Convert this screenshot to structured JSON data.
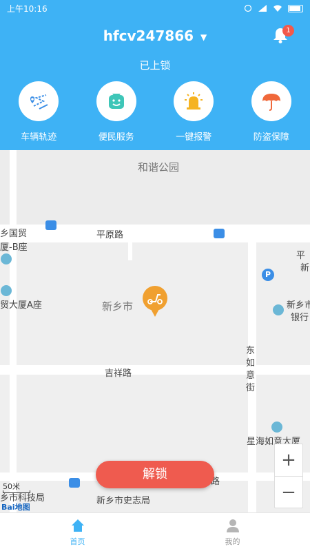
{
  "status_bar": {
    "time": "上午10:16"
  },
  "header": {
    "device_name": "hfcv247866",
    "notification_count": "1",
    "lock_status": "已上锁"
  },
  "quick_actions": [
    {
      "label": "车辆轨迹",
      "icon": "route-icon"
    },
    {
      "label": "便民服务",
      "icon": "service-icon"
    },
    {
      "label": "一键报警",
      "icon": "alarm-icon"
    },
    {
      "label": "防盗保障",
      "icon": "umbrella-icon"
    }
  ],
  "map": {
    "labels": {
      "park": "和谐公园",
      "road_pingyuan": "平原路",
      "building_left_top": "乡国贸",
      "building_left_top2": "厦-B座",
      "building_left_mid": "贸大厦A座",
      "city_center": "新乡市",
      "road_jixiang": "吉祥路",
      "street_dongru_1": "东",
      "street_dongru_2": "如",
      "street_dongru_3": "意",
      "street_dongru_4": "街",
      "bank_1": "新乡市",
      "bank_2": "银行",
      "right_top_1": "平",
      "right_top_2": "新",
      "star_building": "星海如意大厦",
      "tech_bureau": "乡市科技局",
      "history_bureau": "新乡市史志局",
      "road_bottom": "路"
    },
    "scale": "50米",
    "logo_bai": "Bai",
    "logo_du": "地图"
  },
  "unlock_button": "解锁",
  "zoom": {
    "plus": "+",
    "minus": "−"
  },
  "tabs": [
    {
      "label": "首页",
      "active": true
    },
    {
      "label": "我的",
      "active": false
    }
  ],
  "colors": {
    "primary": "#3eb2f5",
    "unlock": "#ef5b4f",
    "pin": "#f0a030"
  }
}
